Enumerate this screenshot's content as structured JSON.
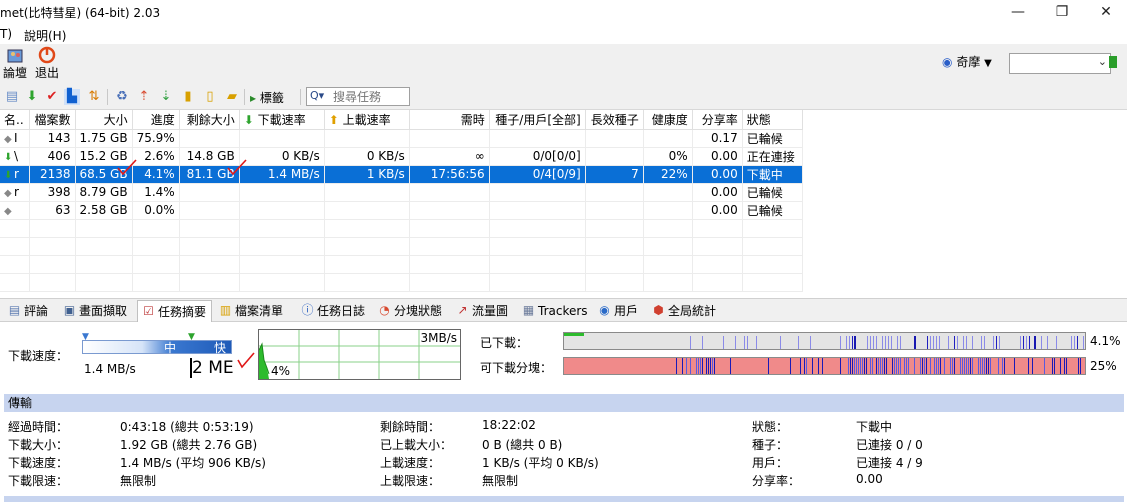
{
  "window": {
    "title": "met(比特彗星) (64-bit) 2.03",
    "min_glyph": "—",
    "max_glyph": "❐",
    "close_glyph": "✕"
  },
  "menu": [
    "T)",
    "說明(H)"
  ],
  "big_toolbar": {
    "items": [
      {
        "label": "論壇"
      },
      {
        "label": "退出"
      }
    ],
    "portal_label": "奇摩",
    "portal_dropdown": "▼"
  },
  "small_toolbar": {
    "tags_label": "標籤",
    "search_placeholder": "搜尋任務",
    "search_icon": "Q▾"
  },
  "table": {
    "headers": [
      "名..",
      "檔案數",
      "大小",
      "進度",
      "剩餘大小",
      "下載速率",
      "上載速率",
      "需時",
      "種子/用戶[全部]",
      "長效種子",
      "健康度",
      "分享率",
      "狀態"
    ],
    "rows": [
      {
        "icon": "diamond",
        "name": "I",
        "files": "143",
        "size": "1.75 GB",
        "progress": "75.9%",
        "remaining": "",
        "down": "",
        "up": "",
        "eta": "",
        "seeds": "",
        "long_seeds": "",
        "health": "",
        "ratio": "0.17",
        "status": "已輪候"
      },
      {
        "icon": "down-arrow",
        "name": "\\",
        "files": "406",
        "size": "15.2 GB",
        "progress": "2.6%",
        "remaining": "14.8 GB",
        "down": "0 KB/s",
        "up": "0 KB/s",
        "eta": "∞",
        "seeds": "0/0[0/0]",
        "long_seeds": "",
        "health": "0%",
        "ratio": "0.00",
        "status": "正在連接"
      },
      {
        "icon": "down-arrow",
        "name": "r",
        "files": "2138",
        "size": "68.5 GB",
        "progress": "4.1%",
        "remaining": "81.1 GB",
        "down": "1.4 MB/s",
        "up": "1 KB/s",
        "eta": "17:56:56",
        "seeds": "0/4[0/9]",
        "long_seeds": "7",
        "health": "22%",
        "ratio": "0.00",
        "status": "下載中",
        "selected": true
      },
      {
        "icon": "diamond",
        "name": "r",
        "files": "398",
        "size": "8.79 GB",
        "progress": "1.4%",
        "remaining": "",
        "down": "",
        "up": "",
        "eta": "",
        "seeds": "",
        "long_seeds": "",
        "health": "",
        "ratio": "0.00",
        "status": "已輪候"
      },
      {
        "icon": "diamond",
        "name": "",
        "files": "63",
        "size": "2.58 GB",
        "progress": "0.0%",
        "remaining": "",
        "down": "",
        "up": "",
        "eta": "",
        "seeds": "",
        "long_seeds": "",
        "health": "",
        "ratio": "0.00",
        "status": "已輪候"
      }
    ]
  },
  "tabs": [
    {
      "label": "評論",
      "icon": "comment-icon",
      "glyph": "▤"
    },
    {
      "label": "畫面擷取",
      "icon": "screenshot-icon",
      "glyph": "▣"
    },
    {
      "label": "任務摘要",
      "icon": "summary-icon",
      "glyph": "☑",
      "active": true
    },
    {
      "label": "檔案清單",
      "icon": "file-list-icon",
      "glyph": "▥"
    },
    {
      "label": "任務日誌",
      "icon": "info-icon",
      "glyph": "ⓘ"
    },
    {
      "label": "分塊狀態",
      "icon": "pie-icon",
      "glyph": "◔"
    },
    {
      "label": "流量圖",
      "icon": "chart-icon",
      "glyph": "↗"
    },
    {
      "label": "Trackers",
      "icon": "tracker-icon",
      "glyph": "▦"
    },
    {
      "label": "用戶",
      "icon": "globe-icon",
      "glyph": "◉"
    },
    {
      "label": "全局統計",
      "icon": "stats-icon",
      "glyph": "⬢"
    }
  ],
  "summary": {
    "speed_label": "下載速度：",
    "speed_value": "1.4 MB/s",
    "slider_mid": "中",
    "slider_fast": "快",
    "limit_display": "2 ME",
    "graph_max": "3MB/s",
    "graph_pct": "4%",
    "downloaded_label": "已下載：",
    "downloaded_pct": "4.1%",
    "downloaded_fraction": 0.041,
    "available_label": "可下載分塊：",
    "available_pct": "25%",
    "section_title": "傳輸",
    "info": [
      [
        {
          "label": "經過時間：",
          "value": "0:43:18 (總共 0:53:19)"
        },
        {
          "label": "剩餘時間：",
          "value": "18:22:02"
        },
        {
          "label": "狀態：",
          "value": "下載中"
        }
      ],
      [
        {
          "label": "下載大小：",
          "value": "1.92 GB (總共 2.76 GB)"
        },
        {
          "label": "已上載大小：",
          "value": "0 B (總共 0 B)"
        },
        {
          "label": "種子：",
          "value": "已連接 0 / 0"
        }
      ],
      [
        {
          "label": "下載速度：",
          "value": "1.4 MB/s (平均 906 KB/s)"
        },
        {
          "label": "上載速度：",
          "value": "1 KB/s (平均 0 KB/s)"
        },
        {
          "label": "用戶：",
          "value": "已連接 4 / 9"
        }
      ],
      [
        {
          "label": "下載限速：",
          "value": "無限制"
        },
        {
          "label": "上載限速：",
          "value": "無限制"
        },
        {
          "label": "分享率：",
          "value": "0.00"
        }
      ]
    ]
  },
  "colors": {
    "selected_row": "#0a6fd6",
    "section_header": "#c7d4ef",
    "graph_line": "#2dbb2d",
    "bar_blue": "#3a3ad8",
    "bar_red": "#f08a8a"
  }
}
